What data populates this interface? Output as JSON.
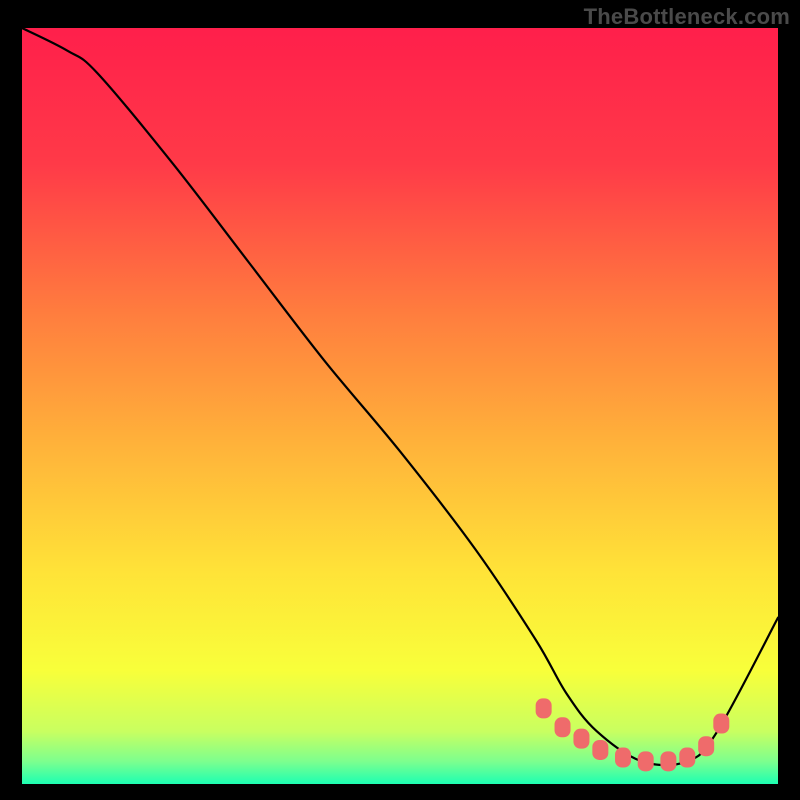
{
  "watermark": "TheBottleneck.com",
  "chart_data": {
    "type": "line",
    "title": "",
    "xlabel": "",
    "ylabel": "",
    "xlim": [
      0,
      100
    ],
    "ylim": [
      0,
      100
    ],
    "grid": false,
    "legend": false,
    "series": [
      {
        "name": "curve",
        "x": [
          0,
          6,
          10,
          20,
          30,
          40,
          50,
          60,
          68,
          72,
          76,
          82,
          88,
          92,
          100
        ],
        "values": [
          100,
          97,
          94,
          82,
          69,
          56,
          44,
          31,
          19,
          12,
          7,
          3,
          3,
          7,
          22
        ]
      }
    ],
    "markers": {
      "name": "valley-markers",
      "x": [
        69,
        71.5,
        74,
        76.5,
        79.5,
        82.5,
        85.5,
        88,
        90.5,
        92.5
      ],
      "values": [
        10,
        7.5,
        6,
        4.5,
        3.5,
        3,
        3,
        3.5,
        5,
        8
      ]
    },
    "gradient_stops": [
      {
        "offset": 0.0,
        "color": "#ff1f4b"
      },
      {
        "offset": 0.18,
        "color": "#ff3a48"
      },
      {
        "offset": 0.38,
        "color": "#ff7e3e"
      },
      {
        "offset": 0.55,
        "color": "#ffb23a"
      },
      {
        "offset": 0.72,
        "color": "#ffe338"
      },
      {
        "offset": 0.85,
        "color": "#f8ff3a"
      },
      {
        "offset": 0.93,
        "color": "#c9ff60"
      },
      {
        "offset": 0.97,
        "color": "#7dff8e"
      },
      {
        "offset": 1.0,
        "color": "#1dffb2"
      }
    ]
  }
}
